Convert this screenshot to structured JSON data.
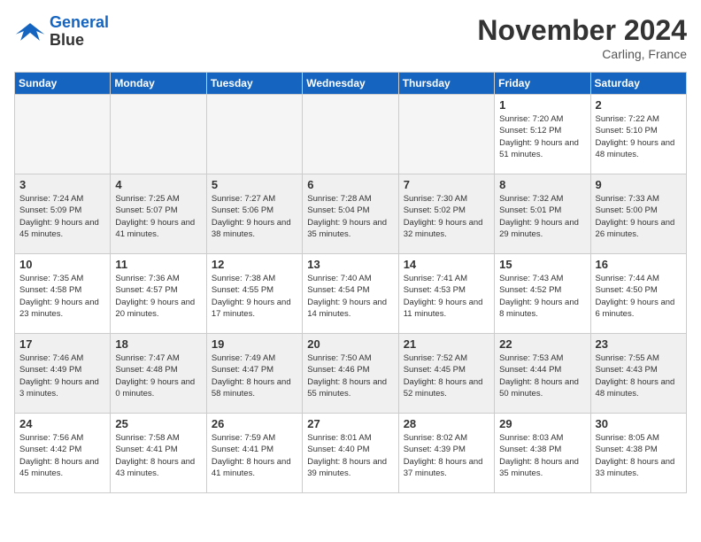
{
  "header": {
    "logo_line1": "General",
    "logo_line2": "Blue",
    "month": "November 2024",
    "location": "Carling, France"
  },
  "weekdays": [
    "Sunday",
    "Monday",
    "Tuesday",
    "Wednesday",
    "Thursday",
    "Friday",
    "Saturday"
  ],
  "weeks": [
    [
      {
        "day": "",
        "info": ""
      },
      {
        "day": "",
        "info": ""
      },
      {
        "day": "",
        "info": ""
      },
      {
        "day": "",
        "info": ""
      },
      {
        "day": "",
        "info": ""
      },
      {
        "day": "1",
        "info": "Sunrise: 7:20 AM\nSunset: 5:12 PM\nDaylight: 9 hours and 51 minutes."
      },
      {
        "day": "2",
        "info": "Sunrise: 7:22 AM\nSunset: 5:10 PM\nDaylight: 9 hours and 48 minutes."
      }
    ],
    [
      {
        "day": "3",
        "info": "Sunrise: 7:24 AM\nSunset: 5:09 PM\nDaylight: 9 hours and 45 minutes."
      },
      {
        "day": "4",
        "info": "Sunrise: 7:25 AM\nSunset: 5:07 PM\nDaylight: 9 hours and 41 minutes."
      },
      {
        "day": "5",
        "info": "Sunrise: 7:27 AM\nSunset: 5:06 PM\nDaylight: 9 hours and 38 minutes."
      },
      {
        "day": "6",
        "info": "Sunrise: 7:28 AM\nSunset: 5:04 PM\nDaylight: 9 hours and 35 minutes."
      },
      {
        "day": "7",
        "info": "Sunrise: 7:30 AM\nSunset: 5:02 PM\nDaylight: 9 hours and 32 minutes."
      },
      {
        "day": "8",
        "info": "Sunrise: 7:32 AM\nSunset: 5:01 PM\nDaylight: 9 hours and 29 minutes."
      },
      {
        "day": "9",
        "info": "Sunrise: 7:33 AM\nSunset: 5:00 PM\nDaylight: 9 hours and 26 minutes."
      }
    ],
    [
      {
        "day": "10",
        "info": "Sunrise: 7:35 AM\nSunset: 4:58 PM\nDaylight: 9 hours and 23 minutes."
      },
      {
        "day": "11",
        "info": "Sunrise: 7:36 AM\nSunset: 4:57 PM\nDaylight: 9 hours and 20 minutes."
      },
      {
        "day": "12",
        "info": "Sunrise: 7:38 AM\nSunset: 4:55 PM\nDaylight: 9 hours and 17 minutes."
      },
      {
        "day": "13",
        "info": "Sunrise: 7:40 AM\nSunset: 4:54 PM\nDaylight: 9 hours and 14 minutes."
      },
      {
        "day": "14",
        "info": "Sunrise: 7:41 AM\nSunset: 4:53 PM\nDaylight: 9 hours and 11 minutes."
      },
      {
        "day": "15",
        "info": "Sunrise: 7:43 AM\nSunset: 4:52 PM\nDaylight: 9 hours and 8 minutes."
      },
      {
        "day": "16",
        "info": "Sunrise: 7:44 AM\nSunset: 4:50 PM\nDaylight: 9 hours and 6 minutes."
      }
    ],
    [
      {
        "day": "17",
        "info": "Sunrise: 7:46 AM\nSunset: 4:49 PM\nDaylight: 9 hours and 3 minutes."
      },
      {
        "day": "18",
        "info": "Sunrise: 7:47 AM\nSunset: 4:48 PM\nDaylight: 9 hours and 0 minutes."
      },
      {
        "day": "19",
        "info": "Sunrise: 7:49 AM\nSunset: 4:47 PM\nDaylight: 8 hours and 58 minutes."
      },
      {
        "day": "20",
        "info": "Sunrise: 7:50 AM\nSunset: 4:46 PM\nDaylight: 8 hours and 55 minutes."
      },
      {
        "day": "21",
        "info": "Sunrise: 7:52 AM\nSunset: 4:45 PM\nDaylight: 8 hours and 52 minutes."
      },
      {
        "day": "22",
        "info": "Sunrise: 7:53 AM\nSunset: 4:44 PM\nDaylight: 8 hours and 50 minutes."
      },
      {
        "day": "23",
        "info": "Sunrise: 7:55 AM\nSunset: 4:43 PM\nDaylight: 8 hours and 48 minutes."
      }
    ],
    [
      {
        "day": "24",
        "info": "Sunrise: 7:56 AM\nSunset: 4:42 PM\nDaylight: 8 hours and 45 minutes."
      },
      {
        "day": "25",
        "info": "Sunrise: 7:58 AM\nSunset: 4:41 PM\nDaylight: 8 hours and 43 minutes."
      },
      {
        "day": "26",
        "info": "Sunrise: 7:59 AM\nSunset: 4:41 PM\nDaylight: 8 hours and 41 minutes."
      },
      {
        "day": "27",
        "info": "Sunrise: 8:01 AM\nSunset: 4:40 PM\nDaylight: 8 hours and 39 minutes."
      },
      {
        "day": "28",
        "info": "Sunrise: 8:02 AM\nSunset: 4:39 PM\nDaylight: 8 hours and 37 minutes."
      },
      {
        "day": "29",
        "info": "Sunrise: 8:03 AM\nSunset: 4:38 PM\nDaylight: 8 hours and 35 minutes."
      },
      {
        "day": "30",
        "info": "Sunrise: 8:05 AM\nSunset: 4:38 PM\nDaylight: 8 hours and 33 minutes."
      }
    ]
  ]
}
